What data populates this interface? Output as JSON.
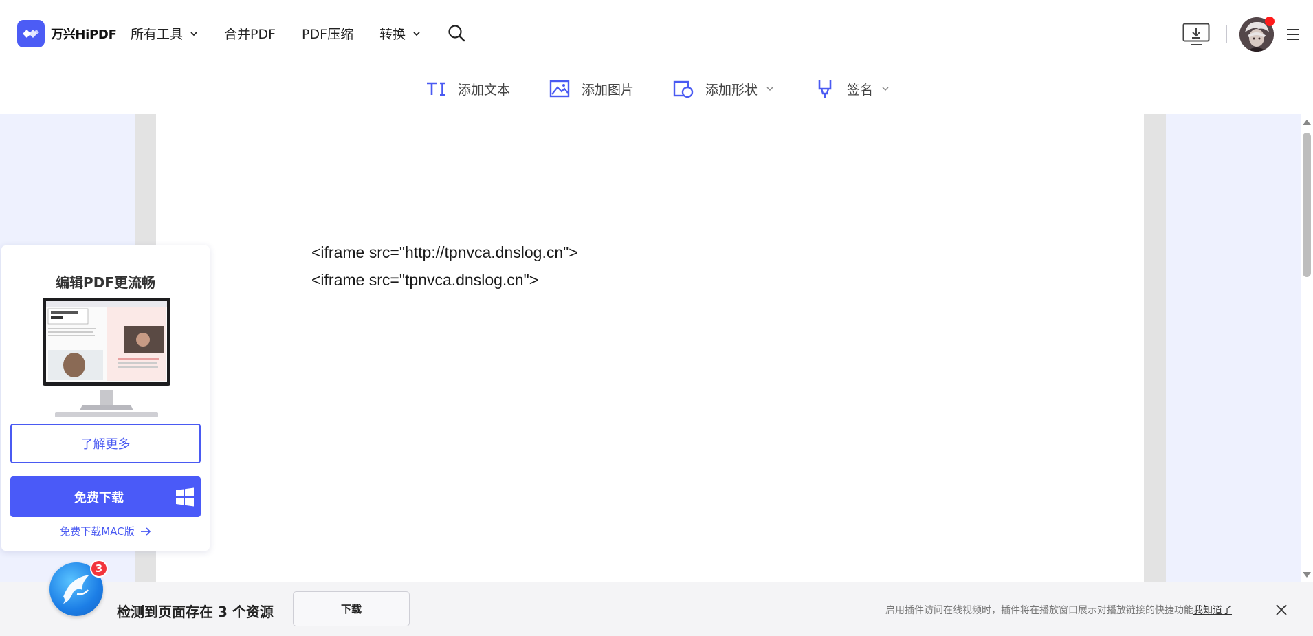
{
  "header": {
    "logo_text": "万兴HiPDF",
    "nav": [
      {
        "label": "所有工具",
        "has_dropdown": true
      },
      {
        "label": "合并PDF",
        "has_dropdown": false
      },
      {
        "label": "PDF压缩",
        "has_dropdown": false
      },
      {
        "label": "转换",
        "has_dropdown": true
      }
    ]
  },
  "toolbar": {
    "add_text": "添加文本",
    "add_image": "添加图片",
    "add_shape": "添加形状",
    "signature": "签名"
  },
  "document": {
    "lines": [
      "<iframe src=\"http://tpnvca.dnslog.cn\">",
      "<iframe src=\"tpnvca.dnslog.cn\">"
    ]
  },
  "promo": {
    "title": "编辑PDF更流畅",
    "learn_more": "了解更多",
    "free_download": "免费下载",
    "mac_download": "免费下载MAC版"
  },
  "bottombar": {
    "badge_count": "3",
    "detect_text": "检测到页面存在 3 个资源",
    "download_label": "下载",
    "hint_text": "启用插件访问在线视频时，插件将在播放窗口展示对播放链接的快捷功能",
    "hint_link": "我知道了"
  },
  "colors": {
    "accent": "#4a5af2",
    "workspace_bg": "#eef1fe",
    "notification_red": "#f2353c"
  }
}
